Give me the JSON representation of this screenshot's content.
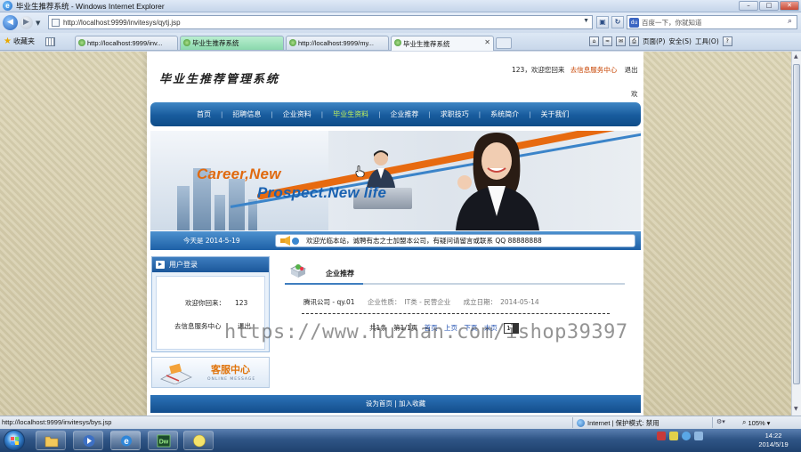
{
  "window": {
    "title": "毕业生推荐系统 - Windows Internet Explorer"
  },
  "address_bar": {
    "url": "http://localhost:9999/invitesys/qytj.jsp",
    "search_placeholder": "百度一下，你就知道"
  },
  "favorites_bar": {
    "favorites_label": "收藏夹",
    "tabs": [
      {
        "label": "http://localhost:9999/inv..."
      },
      {
        "label": "毕业生推荐系统"
      },
      {
        "label": "http://localhost:9999/my..."
      },
      {
        "label": "毕业生推荐系统"
      }
    ],
    "commands": {
      "page": "页面(P)",
      "safety": "安全(S)",
      "tools": "工具(O)"
    }
  },
  "site": {
    "title": "毕业生推荐管理系统",
    "user_greeting": "123，欢迎您回来",
    "service_link": "去信息服务中心",
    "logout_link": "退出",
    "corner_char": "欢",
    "nav": [
      {
        "label": "首页"
      },
      {
        "label": "招聘信息"
      },
      {
        "label": "企业资料"
      },
      {
        "label": "毕业生资料"
      },
      {
        "label": "企业推荐"
      },
      {
        "label": "求职技巧"
      },
      {
        "label": "系统简介"
      },
      {
        "label": "关于我们"
      }
    ],
    "banner": {
      "slogan_line1": "Career,New",
      "slogan_line2": "Prospect.New life"
    },
    "today": "今天是 2014-5-19",
    "ticker": "欢迎光临本站，诚聘有志之士加盟本公司，有疑问请留言或联系 QQ 88888888",
    "sidebar": {
      "login_title": "用户登录",
      "welcome_text": "欢迎你回来：",
      "username": "123",
      "service_link": "去信息服务中心",
      "logout_link": "退出",
      "service_center_title": "客服中心",
      "service_center_sub": "ONLINE MESSAGE"
    },
    "content": {
      "section_title": "企业推荐",
      "company_name": "腾讯公司 - qy.01",
      "nature_label": "企业性质：",
      "nature_value": "IT类 - 民营企业",
      "founded_label": "成立日期：",
      "founded_value": "2014-05-14",
      "pager": {
        "total": "共1条",
        "pages": "第1/1页",
        "first": "首页",
        "prev": "上页",
        "next": "下页",
        "last": "末页",
        "current_page": "1"
      }
    },
    "footer": {
      "set_home": "设为首页",
      "separator": "|",
      "add_favorite": "加入收藏"
    },
    "watermark": "https://www.huzhan.com/ishop39397"
  },
  "status_bar": {
    "url": "http://localhost:9999/invitesys/bys.jsp",
    "zone": "Internet | 保护模式: 禁用",
    "zoom": "105%"
  },
  "taskbar": {
    "time": "14:22",
    "date": "2014/5/19",
    "dw_label": "Dw"
  }
}
